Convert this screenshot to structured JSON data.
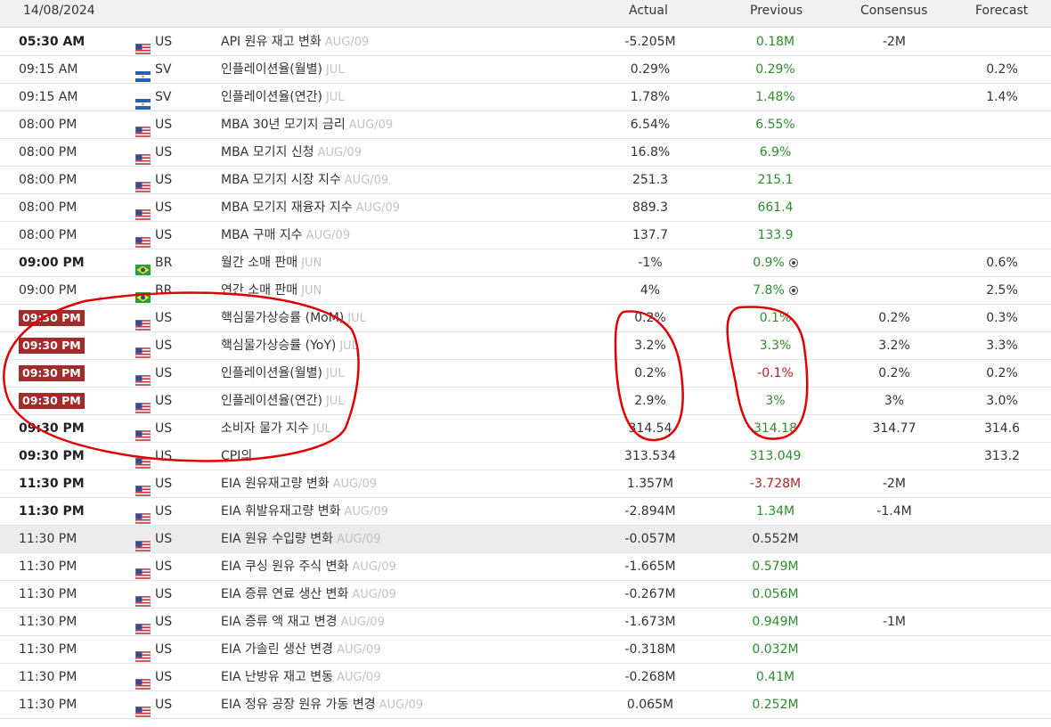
{
  "header": {
    "date": "14/08/2024",
    "actual": "Actual",
    "previous": "Previous",
    "consensus": "Consensus",
    "forecast": "Forecast"
  },
  "rows": [
    {
      "time": "05:30 AM",
      "style": "bold",
      "country": "US",
      "flag": "us",
      "event": "API 원유 재고 변화",
      "period": "AUG/09",
      "actual": "-5.205M",
      "previous": "0.18M",
      "prev_color": "green",
      "consensus": "-2M",
      "forecast": ""
    },
    {
      "time": "09:15 AM",
      "style": "normal",
      "country": "SV",
      "flag": "sv",
      "event": "인플레이션율(월별)",
      "period": "JUL",
      "actual": "0.29%",
      "previous": "0.29%",
      "prev_color": "green",
      "consensus": "",
      "forecast": "0.2%"
    },
    {
      "time": "09:15 AM",
      "style": "normal",
      "country": "SV",
      "flag": "sv",
      "event": "인플레이션율(연간)",
      "period": "JUL",
      "actual": "1.78%",
      "previous": "1.48%",
      "prev_color": "green",
      "consensus": "",
      "forecast": "1.4%"
    },
    {
      "time": "08:00 PM",
      "style": "normal",
      "country": "US",
      "flag": "us",
      "event": "MBA 30년 모기지 금리",
      "period": "AUG/09",
      "actual": "6.54%",
      "previous": "6.55%",
      "prev_color": "green",
      "consensus": "",
      "forecast": ""
    },
    {
      "time": "08:00 PM",
      "style": "normal",
      "country": "US",
      "flag": "us",
      "event": "MBA 모기지 신청",
      "period": "AUG/09",
      "actual": "16.8%",
      "previous": "6.9%",
      "prev_color": "green",
      "consensus": "",
      "forecast": ""
    },
    {
      "time": "08:00 PM",
      "style": "normal",
      "country": "US",
      "flag": "us",
      "event": "MBA 모기지 시장 지수",
      "period": "AUG/09",
      "actual": "251.3",
      "previous": "215.1",
      "prev_color": "green",
      "consensus": "",
      "forecast": ""
    },
    {
      "time": "08:00 PM",
      "style": "normal",
      "country": "US",
      "flag": "us",
      "event": "MBA 모기지 재융자 지수",
      "period": "AUG/09",
      "actual": "889.3",
      "previous": "661.4",
      "prev_color": "green",
      "consensus": "",
      "forecast": ""
    },
    {
      "time": "08:00 PM",
      "style": "normal",
      "country": "US",
      "flag": "us",
      "event": "MBA 구매 지수",
      "period": "AUG/09",
      "actual": "137.7",
      "previous": "133.9",
      "prev_color": "green",
      "consensus": "",
      "forecast": ""
    },
    {
      "time": "09:00 PM",
      "style": "bold",
      "country": "BR",
      "flag": "br",
      "event": "월간 소매 판매",
      "period": "JUN",
      "actual": "-1%",
      "previous": "0.9%",
      "prev_color": "green",
      "revised": true,
      "consensus": "",
      "forecast": "0.6%"
    },
    {
      "time": "09:00 PM",
      "style": "normal",
      "country": "BR",
      "flag": "br",
      "event": "연간 소매 판매",
      "period": "JUN",
      "actual": "4%",
      "previous": "7.8%",
      "prev_color": "green",
      "revised": true,
      "consensus": "",
      "forecast": "2.5%"
    },
    {
      "time": "09:30 PM",
      "style": "badge",
      "country": "US",
      "flag": "us",
      "event": "핵심물가상승률 (MoM)",
      "period": "JUL",
      "actual": "0.2%",
      "previous": "0.1%",
      "prev_color": "green",
      "consensus": "0.2%",
      "forecast": "0.3%"
    },
    {
      "time": "09:30 PM",
      "style": "badge",
      "country": "US",
      "flag": "us",
      "event": "핵심물가상승률 (YoY)",
      "period": "JUL",
      "actual": "3.2%",
      "previous": "3.3%",
      "prev_color": "green",
      "consensus": "3.2%",
      "forecast": "3.3%"
    },
    {
      "time": "09:30 PM",
      "style": "badge",
      "country": "US",
      "flag": "us",
      "event": "인플레이션율(월별)",
      "period": "JUL",
      "actual": "0.2%",
      "previous": "-0.1%",
      "prev_color": "red",
      "consensus": "0.2%",
      "forecast": "0.2%"
    },
    {
      "time": "09:30 PM",
      "style": "badge",
      "country": "US",
      "flag": "us",
      "event": "인플레이션율(연간)",
      "period": "JUL",
      "actual": "2.9%",
      "previous": "3%",
      "prev_color": "green",
      "consensus": "3%",
      "forecast": "3.0%"
    },
    {
      "time": "09:30 PM",
      "style": "bold",
      "country": "US",
      "flag": "us",
      "event": "소비자 물가 지수",
      "period": "JUL",
      "actual": "314.54",
      "previous": "314.18",
      "prev_color": "green",
      "consensus": "314.77",
      "forecast": "314.6"
    },
    {
      "time": "09:30 PM",
      "style": "bold",
      "country": "US",
      "flag": "us",
      "event": "CPI의",
      "period": "",
      "actual": "313.534",
      "previous": "313.049",
      "prev_color": "green",
      "consensus": "",
      "forecast": "313.2"
    },
    {
      "time": "11:30 PM",
      "style": "bold",
      "country": "US",
      "flag": "us",
      "event": "EIA 원유재고량 변화",
      "period": "AUG/09",
      "actual": "1.357M",
      "previous": "-3.728M",
      "prev_color": "red",
      "consensus": "-2M",
      "forecast": ""
    },
    {
      "time": "11:30 PM",
      "style": "bold",
      "country": "US",
      "flag": "us",
      "event": "EIA 휘발유재고량 변화",
      "period": "AUG/09",
      "actual": "-2.894M",
      "previous": "1.34M",
      "prev_color": "green",
      "consensus": "-1.4M",
      "forecast": ""
    },
    {
      "time": "11:30 PM",
      "style": "normal",
      "highlight": true,
      "country": "US",
      "flag": "us",
      "event": "EIA 원유 수입량 변화",
      "period": "AUG/09",
      "actual": "-0.057M",
      "previous": "0.552M",
      "prev_color": "plain",
      "consensus": "",
      "forecast": ""
    },
    {
      "time": "11:30 PM",
      "style": "normal",
      "country": "US",
      "flag": "us",
      "event": "EIA 쿠싱 원유 주식 변화",
      "period": "AUG/09",
      "actual": "-1.665M",
      "previous": "0.579M",
      "prev_color": "green",
      "consensus": "",
      "forecast": ""
    },
    {
      "time": "11:30 PM",
      "style": "normal",
      "country": "US",
      "flag": "us",
      "event": "EIA 증류 연료 생산 변화",
      "period": "AUG/09",
      "actual": "-0.267M",
      "previous": "0.056M",
      "prev_color": "green",
      "consensus": "",
      "forecast": ""
    },
    {
      "time": "11:30 PM",
      "style": "normal",
      "country": "US",
      "flag": "us",
      "event": "EIA 증류 액 재고 변경",
      "period": "AUG/09",
      "actual": "-1.673M",
      "previous": "0.949M",
      "prev_color": "green",
      "consensus": "-1M",
      "forecast": ""
    },
    {
      "time": "11:30 PM",
      "style": "normal",
      "country": "US",
      "flag": "us",
      "event": "EIA 가솔린 생산 변경",
      "period": "AUG/09",
      "actual": "-0.318M",
      "previous": "0.032M",
      "prev_color": "green",
      "consensus": "",
      "forecast": ""
    },
    {
      "time": "11:30 PM",
      "style": "normal",
      "country": "US",
      "flag": "us",
      "event": "EIA 난방유 재고 변동",
      "period": "AUG/09",
      "actual": "-0.268M",
      "previous": "0.41M",
      "prev_color": "green",
      "consensus": "",
      "forecast": ""
    },
    {
      "time": "11:30 PM",
      "style": "normal",
      "country": "US",
      "flag": "us",
      "event": "EIA 정유 공장 원유 가동 변경",
      "period": "AUG/09",
      "actual": "0.065M",
      "previous": "0.252M",
      "prev_color": "green",
      "consensus": "",
      "forecast": ""
    }
  ],
  "colors": {
    "badge_bg": "#a22b2b",
    "positive": "#2e8b2e",
    "negative": "#b02424",
    "annotation": "#e00000"
  }
}
